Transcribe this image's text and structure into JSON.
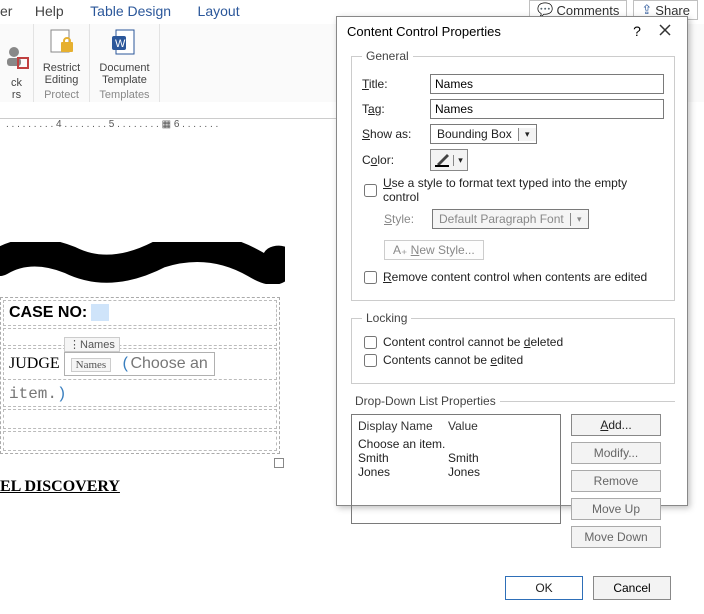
{
  "ribbon_tabs": {
    "t0": "er",
    "t1": "Help",
    "t2": "Table Design",
    "t3": "Layout"
  },
  "top_actions": {
    "comments": "Comments",
    "share": "Share"
  },
  "ribbon_groups": {
    "block": {
      "line1": "ck",
      "line2": "rs"
    },
    "restrict": {
      "line1": "Restrict",
      "line2": "Editing"
    },
    "template": {
      "line1": "Document",
      "line2": "Template"
    },
    "cap_protect": "Protect",
    "cap_templates": "Templates"
  },
  "ruler_text": ". . . . . . . . . 4 . . . . . . . . 5 . . . . . . . . ▦ 6 . . . . . . .",
  "doc": {
    "caseno": "CASE NO:",
    "names_tag": "Names",
    "names_tag2": "Names",
    "judge": "JUDGE",
    "placeholder_part1": "Choose an",
    "placeholder_part2": "item.",
    "discovery": "EL DISCOVERY"
  },
  "dialog": {
    "title": "Content Control Properties",
    "help": "?",
    "close": "×",
    "general": {
      "legend": "General",
      "title_label": "Title:",
      "title_value": "Names",
      "tag_label": "Tag:",
      "tag_value": "Names",
      "showas_label": "Show as:",
      "showas_value": "Bounding Box",
      "color_label": "Color:",
      "use_style": "Use a style to format text typed into the empty control",
      "style_label": "Style:",
      "style_value": "Default Paragraph Font",
      "new_style": "New Style...",
      "remove_cc": "Remove content control when contents are edited"
    },
    "locking": {
      "legend": "Locking",
      "no_delete": "Content control cannot be deleted",
      "no_edit": "Contents cannot be edited"
    },
    "dd": {
      "legend": "Drop-Down List Properties",
      "hdr_name": "Display Name",
      "hdr_value": "Value",
      "r0": {
        "name": "Choose an item.",
        "value": ""
      },
      "r1": {
        "name": "Smith",
        "value": "Smith"
      },
      "r2": {
        "name": "Jones",
        "value": "Jones"
      },
      "btn_add": "Add...",
      "btn_modify": "Modify...",
      "btn_remove": "Remove",
      "btn_up": "Move Up",
      "btn_down": "Move Down"
    },
    "ok": "OK",
    "cancel": "Cancel"
  }
}
